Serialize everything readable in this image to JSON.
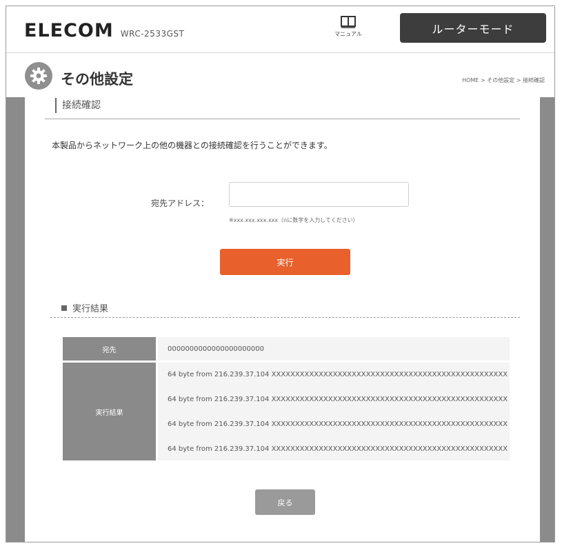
{
  "header": {
    "logo": "ELECOM",
    "model": "WRC-2533GST",
    "manual_label": "マニュアル",
    "mode_label": "ルーターモード"
  },
  "page": {
    "title": "その他設定",
    "breadcrumb": "HOME > その他設定 > 接続確認"
  },
  "section": {
    "heading": "接続確認",
    "description": "本製品からネットワーク上の他の機器との接続確認を行うことができます。",
    "address_label": "宛先アドレス：",
    "address_value": "",
    "address_hint": "※xxx.xxx.xxx.xxx（nに数字を入力してください）",
    "exec_button": "実行"
  },
  "result": {
    "heading": "実行結果",
    "dest_label": "宛先",
    "dest_value": "0000000000000000000000",
    "output_label": "実行結果",
    "output_lines": [
      "64 byte from 216.239.37.104 XXXXXXXXXXXXXXXXXXXXXXXXXXXXXXXXXXXXXXXXXXXXXXXXXX",
      "64 byte from 216.239.37.104 XXXXXXXXXXXXXXXXXXXXXXXXXXXXXXXXXXXXXXXXXXXXXXXXXX",
      "64 byte from 216.239.37.104 XXXXXXXXXXXXXXXXXXXXXXXXXXXXXXXXXXXXXXXXXXXXXXXXXX",
      "64 byte from 216.239.37.104 XXXXXXXXXXXXXXXXXXXXXXXXXXXXXXXXXXXXXXXXXXXXXXXXXX"
    ],
    "back_button": "戻る"
  },
  "colors": {
    "accent": "#e8602b",
    "mode_button": "#3d3d3d",
    "rail": "#8b8b8b"
  }
}
